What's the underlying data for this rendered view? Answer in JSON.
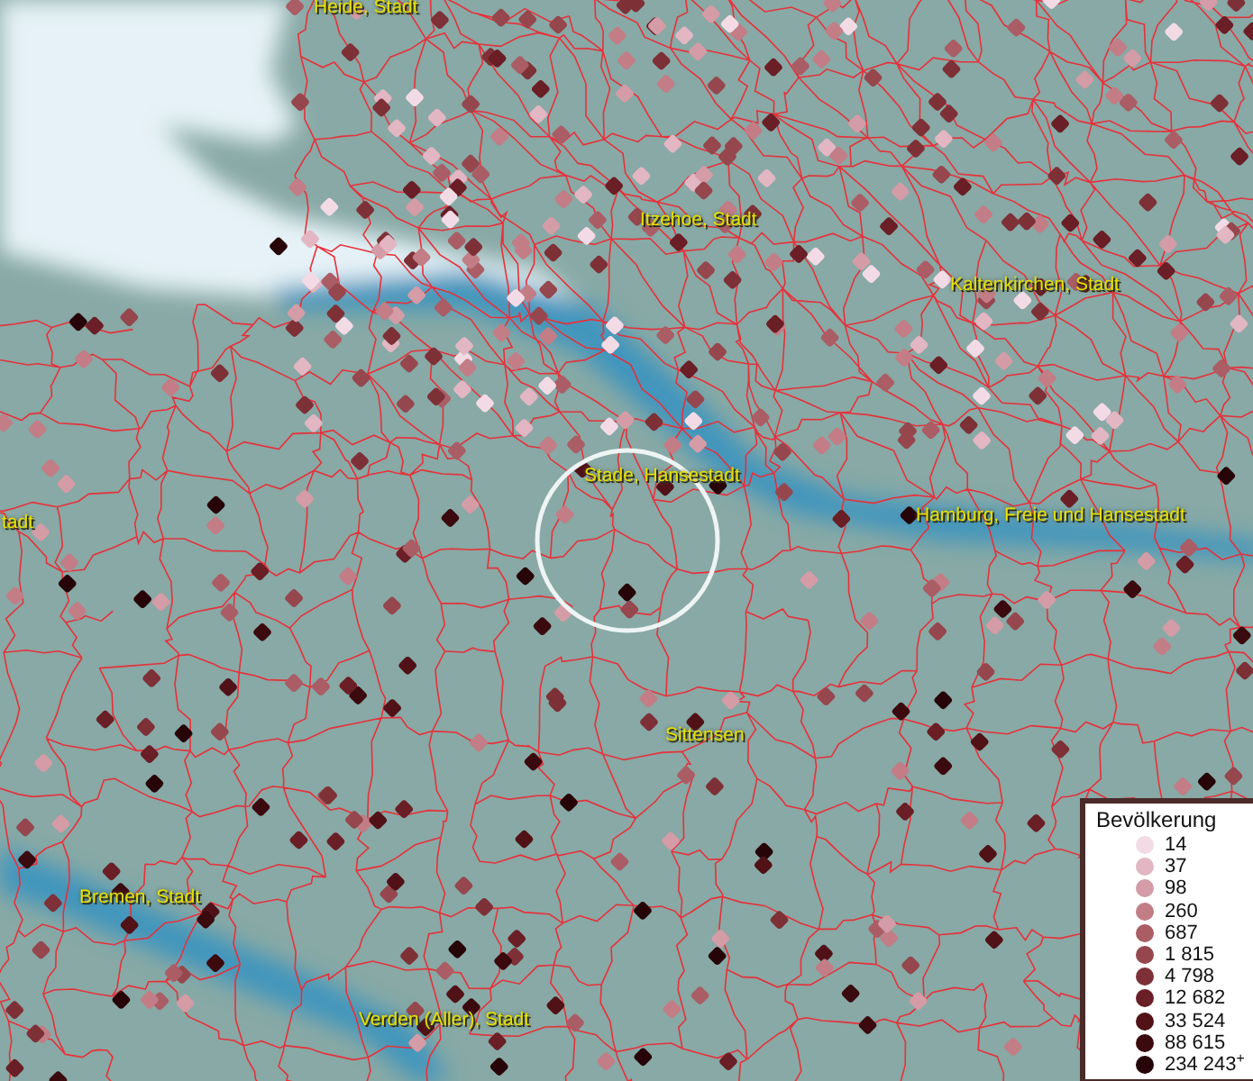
{
  "map": {
    "places": [
      {
        "name": "Heide, Stadt"
      },
      {
        "name": "Itzehoe, Stadt"
      },
      {
        "name": "Kaltenkirchen, Stadt"
      },
      {
        "name": "tadt"
      },
      {
        "name": "Stade, Hansestadt"
      },
      {
        "name": "Hamburg, Freie und Hansestadt"
      },
      {
        "name": "Sittensen"
      },
      {
        "name": "Bremen, Stadt"
      },
      {
        "name": "Verden (Aller), Stadt"
      }
    ]
  },
  "legend": {
    "title": "Bevölkerung",
    "items": [
      {
        "label": "14",
        "color": "#f3dbe6"
      },
      {
        "label": "37",
        "color": "#e2b6c2"
      },
      {
        "label": "98",
        "color": "#d49ca6"
      },
      {
        "label": "260",
        "color": "#c27d86"
      },
      {
        "label": "687",
        "color": "#aa5d65"
      },
      {
        "label": "1 815",
        "color": "#95474d"
      },
      {
        "label": "4 798",
        "color": "#7e3037"
      },
      {
        "label": "12 682",
        "color": "#6a1e25"
      },
      {
        "label": "33 524",
        "color": "#501217"
      },
      {
        "label": "88 615",
        "color": "#3b0a0e"
      },
      {
        "label": "234 243$^{+}$",
        "color": "#260407"
      }
    ]
  }
}
